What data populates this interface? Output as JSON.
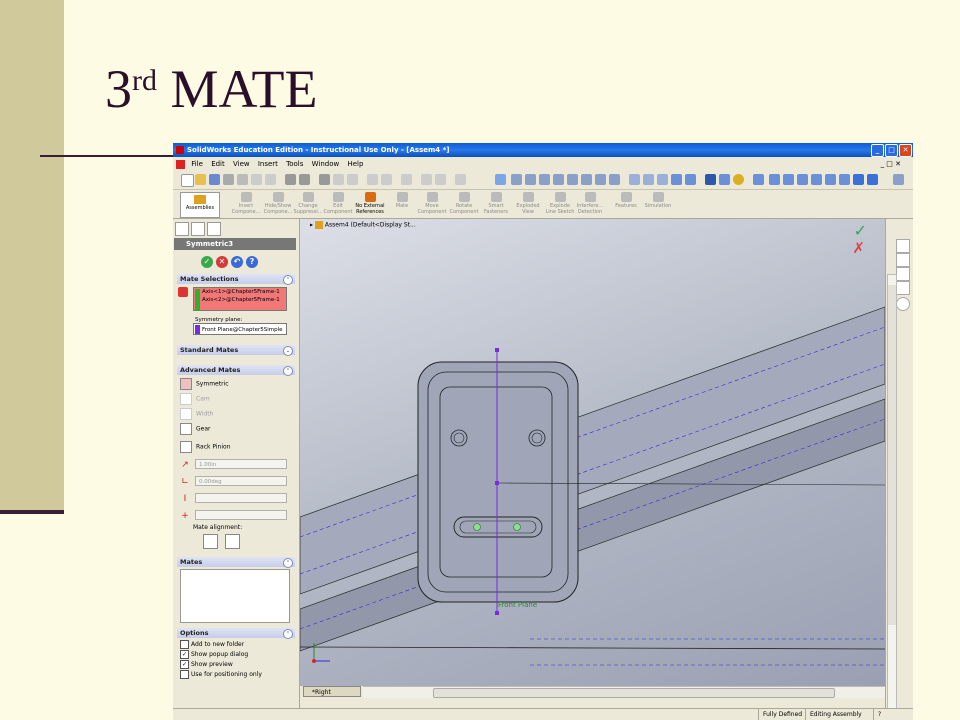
{
  "slide": {
    "title_main": "3",
    "title_sup": "rd",
    "title_rest": " MATE"
  },
  "window": {
    "title": "SolidWorks Education Edition - Instructional Use Only - [Assem4 *]",
    "min": "_",
    "max": "□",
    "close": "✕"
  },
  "menu": [
    "File",
    "Edit",
    "View",
    "Insert",
    "Tools",
    "Window",
    "Help"
  ],
  "commandmanager": {
    "assemblies_label": "Assemblies",
    "buttons": [
      {
        "label": "Insert Compone...",
        "active": false
      },
      {
        "label": "Hide/Show Compone...",
        "active": false
      },
      {
        "label": "Change Suppressi...",
        "active": false
      },
      {
        "label": "Edit Component",
        "active": false
      },
      {
        "label": "No External References",
        "active": true
      },
      {
        "label": "Mate",
        "active": false
      },
      {
        "label": "Move Component",
        "active": false
      },
      {
        "label": "Rotate Component",
        "active": false
      },
      {
        "label": "Smart Fasteners",
        "active": false
      },
      {
        "label": "Exploded View",
        "active": false
      },
      {
        "label": "Explode Line Sketch",
        "active": false
      },
      {
        "label": "Interfere... Detection",
        "active": false
      },
      {
        "label": "Features",
        "active": false
      },
      {
        "label": "Simulation",
        "active": false
      }
    ]
  },
  "property_manager": {
    "title": "Symmetric3",
    "mate_selections": {
      "header": "Mate Selections",
      "items": [
        "Axis<1>@Chapter5Frame-1",
        "Axis<2>@Chapter5Frame-1"
      ],
      "symmetry_label": "Symmetry plane:",
      "symmetry_value": "Front Plane@Chapter5Simple"
    },
    "standard_mates_header": "Standard Mates",
    "advanced_mates": {
      "header": "Advanced Mates",
      "items": [
        {
          "label": "Symmetric",
          "enabled": true
        },
        {
          "label": "Cam",
          "enabled": false
        },
        {
          "label": "Width",
          "enabled": false
        },
        {
          "label": "Gear",
          "enabled": true
        },
        {
          "label": "Rack Pinion",
          "enabled": true
        }
      ],
      "distance_value": "1.00in",
      "angle_value": "0.00deg",
      "alignment_label": "Mate alignment:"
    },
    "mates_header": "Mates",
    "options": {
      "header": "Options",
      "items": [
        {
          "label": "Add to new folder",
          "checked": false
        },
        {
          "label": "Show popup dialog",
          "checked": true
        },
        {
          "label": "Show preview",
          "checked": true
        },
        {
          "label": "Use for positioning only",
          "checked": false
        }
      ]
    }
  },
  "graphics": {
    "tree_label": "Assem4  (Default<Display St...",
    "plane_label": "Front Plane",
    "view_tab": "*Right"
  },
  "status": {
    "defined": "Fully Defined",
    "mode": "Editing Assembly",
    "help": "?"
  },
  "colors": {
    "accent_blue": "#0a5cd8",
    "selection_red": "#f27777",
    "symmetry_purple": "#7a2ae0",
    "check_green": "#3aa84a"
  }
}
